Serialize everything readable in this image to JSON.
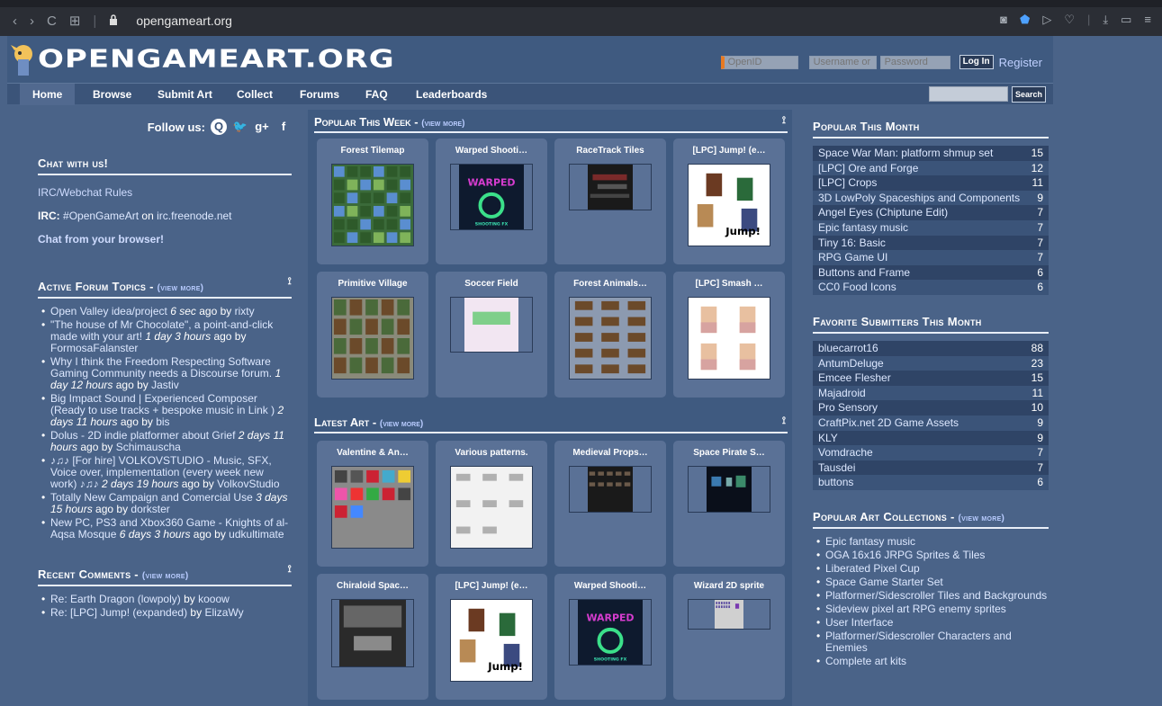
{
  "browser": {
    "back": "‹",
    "forward": "›",
    "reload": "C",
    "grid": "⊞",
    "lock": "🔒",
    "url": "opengameart.org"
  },
  "header": {
    "logo_text": "OPENGAMEART.ORG",
    "openid_placeholder": "OpenID",
    "username_placeholder": "Username or",
    "password_placeholder": "Password",
    "login_label": "Log In",
    "register_label": "Register"
  },
  "nav": {
    "items": [
      "Home",
      "Browse",
      "Submit Art",
      "Collect",
      "Forums",
      "FAQ",
      "Leaderboards"
    ],
    "search_label": "Search"
  },
  "left": {
    "follow_label": "Follow us:",
    "chat_heading": "Chat with us!",
    "irc_rules": "IRC/Webchat Rules",
    "irc_prefix": "IRC:",
    "irc_channel": "#OpenGameArt",
    "irc_on": "on",
    "irc_server": "irc.freenode.net",
    "chat_browser": "Chat from your browser!",
    "forum_heading": "Active Forum Topics -",
    "forum_viewmore": "(view more)",
    "forum_topics": [
      {
        "title": "Open Valley idea/project",
        "time": "6 sec",
        "by": "rixty"
      },
      {
        "title": "\"The house of Mr Chocolate\", a point-and-click made with your art!",
        "time": "1 day 3 hours",
        "by": "FormosaFalanster"
      },
      {
        "title": "Why I think the Freedom Respecting Software Gaming Community needs a Discourse forum.",
        "time": "1 day 12 hours",
        "by": "Jastiv"
      },
      {
        "title": "Big Impact Sound | Experienced Composer (Ready to use tracks + bespoke music in Link )",
        "time": "2 days 11 hours",
        "by": "bis"
      },
      {
        "title": "Dolus - 2D indie platformer about Grief",
        "time": "2 days 11 hours",
        "by": "Schimauscha"
      },
      {
        "title": "♪♫♪ [For hire] VOLKOVSTUDIO - Music, SFX, Voice over, implementation (every week new work) ♪♫♪",
        "time": "2 days 19 hours",
        "by": "VolkovStudio"
      },
      {
        "title": "Totally New Campaign and Comercial Use",
        "time": "3 days 15 hours",
        "by": "dorkster"
      },
      {
        "title": "New PC, PS3 and Xbox360 Game - Knights of al-Aqsa Mosque",
        "time": "6 days 3 hours",
        "by": "udkultimate"
      }
    ],
    "ago": "ago by",
    "comments_heading": "Recent Comments -",
    "comments_viewmore": "(view more)",
    "comments": [
      {
        "title": "Re: Earth Dragon (lowpoly)",
        "by": "kooow"
      },
      {
        "title": "Re: [LPC] Jump! (expanded)",
        "by": "ElizaWy"
      }
    ],
    "by": "by"
  },
  "middle": {
    "popular_heading": "Popular This Week -",
    "popular_viewmore": "(view more)",
    "popular": [
      "Forest Tilemap",
      "Warped Shooti…",
      "RaceTrack Tiles",
      "[LPC] Jump! (e…",
      "Primitive Village",
      "Soccer Field",
      "Forest Animals…",
      "[LPC] Smash …"
    ],
    "latest_heading": "Latest Art -",
    "latest_viewmore": "(view more)",
    "latest": [
      "Valentine & An…",
      "Various patterns.",
      "Medieval Props…",
      "Space Pirate S…",
      "Chiraloid Spac…",
      "[LPC] Jump! (e…",
      "Warped Shooti…",
      "Wizard 2D sprite"
    ],
    "warped_text": "WARPED",
    "warped_sub": "SHOOTING FX",
    "jump_text": "Jump!"
  },
  "right": {
    "month_heading": "Popular This Month",
    "month": [
      {
        "name": "Space War Man: platform shmup set",
        "n": "15"
      },
      {
        "name": "[LPC] Ore and Forge",
        "n": "12"
      },
      {
        "name": "[LPC] Crops",
        "n": "11"
      },
      {
        "name": "3D LowPoly Spaceships and Components",
        "n": "9"
      },
      {
        "name": "Angel Eyes (Chiptune Edit)",
        "n": "7"
      },
      {
        "name": "Epic fantasy music",
        "n": "7"
      },
      {
        "name": "Tiny 16: Basic",
        "n": "7"
      },
      {
        "name": "RPG Game UI",
        "n": "7"
      },
      {
        "name": "Buttons and Frame",
        "n": "6"
      },
      {
        "name": "CC0 Food Icons",
        "n": "6"
      }
    ],
    "submitters_heading": "Favorite Submitters This Month",
    "submitters": [
      {
        "name": "bluecarrot16",
        "n": "88"
      },
      {
        "name": "AntumDeluge",
        "n": "23"
      },
      {
        "name": "Emcee Flesher",
        "n": "15"
      },
      {
        "name": "Majadroid",
        "n": "11"
      },
      {
        "name": "Pro Sensory",
        "n": "10"
      },
      {
        "name": "CraftPix.net 2D Game Assets",
        "n": "9"
      },
      {
        "name": "KLY",
        "n": "9"
      },
      {
        "name": "Vomdrache",
        "n": "7"
      },
      {
        "name": "Tausdei",
        "n": "7"
      },
      {
        "name": "buttons",
        "n": "6"
      }
    ],
    "collections_heading": "Popular Art Collections -",
    "collections_viewmore": "(view more)",
    "collections": [
      "Epic fantasy music",
      "OGA 16x16 JRPG Sprites & Tiles",
      "Liberated Pixel Cup",
      "Space Game Starter Set",
      "Platformer/Sidescroller Tiles and Backgrounds",
      "Sideview pixel art RPG enemy sprites",
      "User Interface",
      "Platformer/Sidescroller Characters and Enemies",
      "Complete art kits"
    ]
  }
}
